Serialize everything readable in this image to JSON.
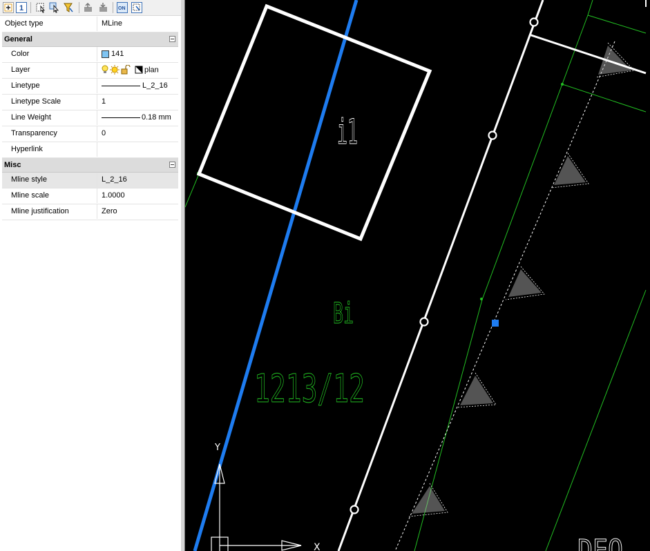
{
  "toolbar": {
    "buttons": [
      "toggle-pickadd-icon",
      "select-objects-icon",
      "quick-select-icon",
      "filter-icon",
      "export-icon",
      "import-icon",
      "on-icon",
      "settings-icon"
    ]
  },
  "properties": {
    "object_type_label": "Object type",
    "object_type_value": "MLine",
    "general": {
      "title": "General",
      "color": {
        "label": "Color",
        "value": "141",
        "swatch": "#7fc4f2"
      },
      "layer": {
        "label": "Layer",
        "value": "plan"
      },
      "linetype": {
        "label": "Linetype",
        "value": "L_2_16"
      },
      "linetype_scale": {
        "label": "Linetype Scale",
        "value": "1"
      },
      "line_weight": {
        "label": "Line Weight",
        "value": "0.18 mm"
      },
      "transparency": {
        "label": "Transparency",
        "value": "0"
      },
      "hyperlink": {
        "label": "Hyperlink",
        "value": ""
      }
    },
    "misc": {
      "title": "Misc",
      "mline_style": {
        "label": "Mline style",
        "value": "L_2_16"
      },
      "mline_scale": {
        "label": "Mline scale",
        "value": "1.0000"
      },
      "mline_justification": {
        "label": "Mline justification",
        "value": "Zero"
      }
    }
  },
  "drawing": {
    "text_i1": "i1",
    "text_bi": "Bi",
    "text_parcel": "1213/12",
    "text_partial": "DEO",
    "ucs_y": "Y",
    "ucs_x": "X",
    "colors": {
      "background": "#000000",
      "white": "#ffffff",
      "green": "#22c022",
      "blue": "#1e7cf0"
    }
  }
}
